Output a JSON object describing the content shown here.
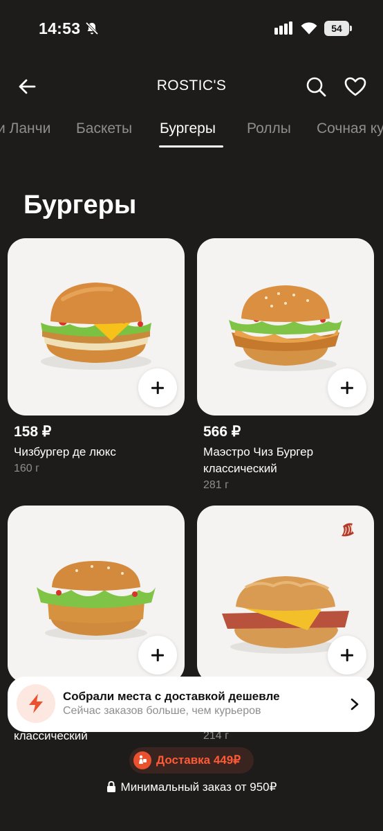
{
  "status_bar": {
    "time": "14:53",
    "battery": "54"
  },
  "header": {
    "title": "ROSTIC'S"
  },
  "tabs": [
    {
      "label": "Ланчи",
      "shown": "и Ланчи"
    },
    {
      "label": "Баскеты"
    },
    {
      "label": "Бургеры",
      "active": true
    },
    {
      "label": "Роллы"
    },
    {
      "label": "Сочная курочка",
      "shown": "Сочная ку"
    }
  ],
  "section": {
    "title": "Бургеры"
  },
  "products": [
    {
      "price": "158 ₽",
      "name": "Чизбургер де люкс",
      "weight": "160 г",
      "image": "burger-cheese-deluxe"
    },
    {
      "price": "566 ₽",
      "name": "Маэстро Чиз Бургер классический",
      "weight": "281 г",
      "image": "burger-maestro"
    },
    {
      "price": "",
      "name": "классический",
      "weight": "",
      "image": "burger-classic"
    },
    {
      "price": "",
      "name": "",
      "weight": "214 г",
      "image": "chicken-fillet-sandwich",
      "badge": "bacon-icon"
    }
  ],
  "banner": {
    "title": "Собрали места с доставкой дешевле",
    "subtitle": "Сейчас заказов больше, чем курьеров",
    "icon": "lightning-icon"
  },
  "delivery": {
    "label": "Доставка 449₽"
  },
  "min_order": {
    "label": "Минимальный заказ от 950₽"
  },
  "colors": {
    "background": "#1d1c1b",
    "accent": "#ff5a36",
    "card": "#f4f3f1"
  }
}
